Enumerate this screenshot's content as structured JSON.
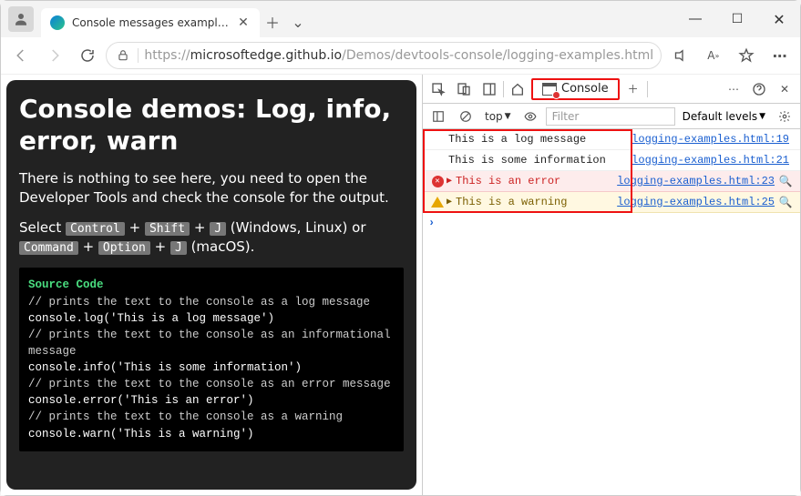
{
  "tab": {
    "title": "Console messages examples: log"
  },
  "url": {
    "host": "https://",
    "domain": "microsoftedge.github.io",
    "path": "/Demos/devtools-console/logging-examples.html"
  },
  "page": {
    "h1": "Console demos: Log, info, error, warn",
    "intro": "There is nothing to see here, you need to open the Developer Tools and check the console for the output.",
    "select_prefix": "Select ",
    "kbd_ctrl": "Control",
    "kbd_shift": "Shift",
    "kbd_j": "J",
    "winlinux": " (Windows, Linux) or ",
    "kbd_cmd": "Command",
    "kbd_opt": "Option",
    "macos": " (macOS).",
    "src_label": "Source Code",
    "code": {
      "c1": "// prints the text to the console as  a log message",
      "l1": "console.log('This is a log message')",
      "c2": "// prints the text to the console as an informational message",
      "l2": "console.info('This is some information')",
      "c3": "// prints the text to the console as an error message",
      "l3": "console.error('This is an error')",
      "c4": "// prints the text to the console as a warning",
      "l4": "console.warn('This is a warning')"
    }
  },
  "devtools": {
    "tab_label": "Console",
    "context": "top",
    "filter_placeholder": "Filter",
    "levels": "Default levels",
    "rows": [
      {
        "msg": "This is a log message",
        "src": "logging-examples.html:19"
      },
      {
        "msg": "This is some information",
        "src": "logging-examples.html:21"
      },
      {
        "msg": "This is an error",
        "src": "logging-examples.html:23"
      },
      {
        "msg": "This is a warning",
        "src": "logging-examples.html:25"
      }
    ],
    "prompt": "›"
  }
}
